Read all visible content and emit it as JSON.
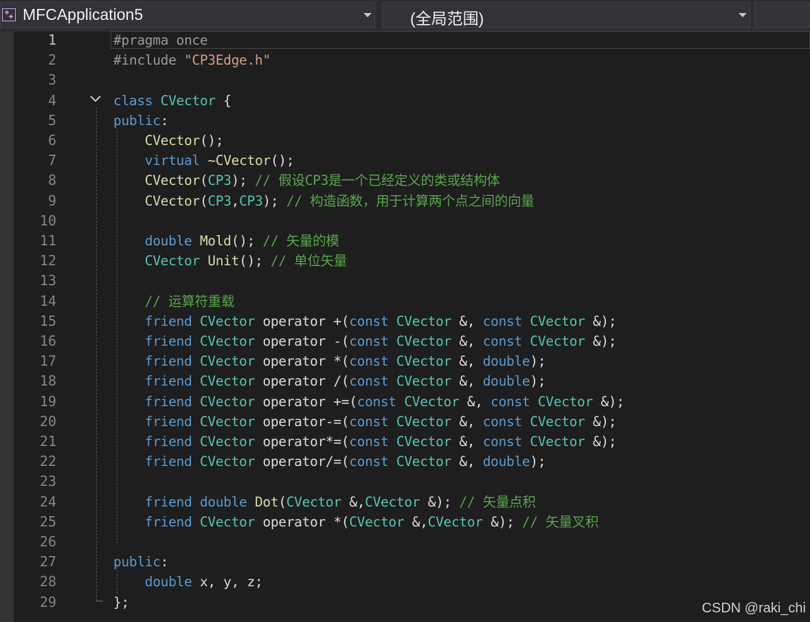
{
  "navbar": {
    "project_name": "MFCApplication5",
    "scope": "(全局范围)",
    "project_icon": "cpp-project-icon",
    "dropdown_icon": "chevron-down-icon"
  },
  "editor": {
    "line_numbers": [
      "1",
      "2",
      "3",
      "4",
      "5",
      "6",
      "7",
      "8",
      "9",
      "10",
      "11",
      "12",
      "13",
      "14",
      "15",
      "16",
      "17",
      "18",
      "19",
      "20",
      "21",
      "22",
      "23",
      "24",
      "25",
      "26",
      "27",
      "28",
      "29"
    ],
    "lines": [
      [
        [
          "pp",
          "#pragma once"
        ]
      ],
      [
        [
          "pp",
          "#include "
        ],
        [
          "str",
          "\"CP3Edge.h\""
        ]
      ],
      [],
      [
        [
          "kw",
          "class "
        ],
        [
          "ty",
          "CVector"
        ],
        [
          "pu",
          " {"
        ]
      ],
      [
        [
          "kw",
          "public"
        ],
        [
          "pu",
          ":"
        ]
      ],
      [
        [
          "pu",
          "    "
        ],
        [
          "fn",
          "CVector"
        ],
        [
          "pu",
          "();"
        ]
      ],
      [
        [
          "pu",
          "    "
        ],
        [
          "kw",
          "virtual "
        ],
        [
          "pu",
          "~"
        ],
        [
          "fn",
          "CVector"
        ],
        [
          "pu",
          "();"
        ]
      ],
      [
        [
          "pu",
          "    "
        ],
        [
          "fn",
          "CVector"
        ],
        [
          "pu",
          "("
        ],
        [
          "ty",
          "CP3"
        ],
        [
          "pu",
          "); "
        ],
        [
          "cm",
          "// 假设CP3是一个已经定义的类或结构体"
        ]
      ],
      [
        [
          "pu",
          "    "
        ],
        [
          "fn",
          "CVector"
        ],
        [
          "pu",
          "("
        ],
        [
          "ty",
          "CP3"
        ],
        [
          "pu",
          ","
        ],
        [
          "ty",
          "CP3"
        ],
        [
          "pu",
          "); "
        ],
        [
          "cm",
          "// 构造函数，用于计算两个点之间的向量"
        ]
      ],
      [],
      [
        [
          "pu",
          "    "
        ],
        [
          "kw",
          "double "
        ],
        [
          "fn",
          "Mold"
        ],
        [
          "pu",
          "(); "
        ],
        [
          "cm",
          "// 矢量的模"
        ]
      ],
      [
        [
          "pu",
          "    "
        ],
        [
          "ty",
          "CVector "
        ],
        [
          "fn",
          "Unit"
        ],
        [
          "pu",
          "(); "
        ],
        [
          "cm",
          "// 单位矢量"
        ]
      ],
      [],
      [
        [
          "pu",
          "    "
        ],
        [
          "cm",
          "// 运算符重载"
        ]
      ],
      [
        [
          "pu",
          "    "
        ],
        [
          "kw",
          "friend "
        ],
        [
          "ty",
          "CVector "
        ],
        [
          "pu",
          "operator +("
        ],
        [
          "kw",
          "const "
        ],
        [
          "ty",
          "CVector "
        ],
        [
          "pu",
          "&, "
        ],
        [
          "kw",
          "const "
        ],
        [
          "ty",
          "CVector "
        ],
        [
          "pu",
          "&);"
        ]
      ],
      [
        [
          "pu",
          "    "
        ],
        [
          "kw",
          "friend "
        ],
        [
          "ty",
          "CVector "
        ],
        [
          "pu",
          "operator -("
        ],
        [
          "kw",
          "const "
        ],
        [
          "ty",
          "CVector "
        ],
        [
          "pu",
          "&, "
        ],
        [
          "kw",
          "const "
        ],
        [
          "ty",
          "CVector "
        ],
        [
          "pu",
          "&);"
        ]
      ],
      [
        [
          "pu",
          "    "
        ],
        [
          "kw",
          "friend "
        ],
        [
          "ty",
          "CVector "
        ],
        [
          "pu",
          "operator *("
        ],
        [
          "kw",
          "const "
        ],
        [
          "ty",
          "CVector "
        ],
        [
          "pu",
          "&, "
        ],
        [
          "kw",
          "double"
        ],
        [
          "pu",
          ");"
        ]
      ],
      [
        [
          "pu",
          "    "
        ],
        [
          "kw",
          "friend "
        ],
        [
          "ty",
          "CVector "
        ],
        [
          "pu",
          "operator /("
        ],
        [
          "kw",
          "const "
        ],
        [
          "ty",
          "CVector "
        ],
        [
          "pu",
          "&, "
        ],
        [
          "kw",
          "double"
        ],
        [
          "pu",
          ");"
        ]
      ],
      [
        [
          "pu",
          "    "
        ],
        [
          "kw",
          "friend "
        ],
        [
          "ty",
          "CVector "
        ],
        [
          "pu",
          "operator +=("
        ],
        [
          "kw",
          "const "
        ],
        [
          "ty",
          "CVector "
        ],
        [
          "pu",
          "&, "
        ],
        [
          "kw",
          "const "
        ],
        [
          "ty",
          "CVector "
        ],
        [
          "pu",
          "&);"
        ]
      ],
      [
        [
          "pu",
          "    "
        ],
        [
          "kw",
          "friend "
        ],
        [
          "ty",
          "CVector "
        ],
        [
          "pu",
          "operator-=("
        ],
        [
          "kw",
          "const "
        ],
        [
          "ty",
          "CVector "
        ],
        [
          "pu",
          "&, "
        ],
        [
          "kw",
          "const "
        ],
        [
          "ty",
          "CVector "
        ],
        [
          "pu",
          "&);"
        ]
      ],
      [
        [
          "pu",
          "    "
        ],
        [
          "kw",
          "friend "
        ],
        [
          "ty",
          "CVector "
        ],
        [
          "pu",
          "operator*=("
        ],
        [
          "kw",
          "const "
        ],
        [
          "ty",
          "CVector "
        ],
        [
          "pu",
          "&, "
        ],
        [
          "kw",
          "const "
        ],
        [
          "ty",
          "CVector "
        ],
        [
          "pu",
          "&);"
        ]
      ],
      [
        [
          "pu",
          "    "
        ],
        [
          "kw",
          "friend "
        ],
        [
          "ty",
          "CVector "
        ],
        [
          "pu",
          "operator/=("
        ],
        [
          "kw",
          "const "
        ],
        [
          "ty",
          "CVector "
        ],
        [
          "pu",
          "&, "
        ],
        [
          "kw",
          "double"
        ],
        [
          "pu",
          ");"
        ]
      ],
      [],
      [
        [
          "pu",
          "    "
        ],
        [
          "kw",
          "friend "
        ],
        [
          "kw",
          "double "
        ],
        [
          "fn",
          "Dot"
        ],
        [
          "pu",
          "("
        ],
        [
          "ty",
          "CVector "
        ],
        [
          "pu",
          "&,"
        ],
        [
          "ty",
          "CVector "
        ],
        [
          "pu",
          "&); "
        ],
        [
          "cm",
          "// 矢量点积"
        ]
      ],
      [
        [
          "pu",
          "    "
        ],
        [
          "kw",
          "friend "
        ],
        [
          "ty",
          "CVector "
        ],
        [
          "pu",
          "operator *("
        ],
        [
          "ty",
          "CVector "
        ],
        [
          "pu",
          "&,"
        ],
        [
          "ty",
          "CVector "
        ],
        [
          "pu",
          "&); "
        ],
        [
          "cm",
          "// 矢量叉积"
        ]
      ],
      [],
      [
        [
          "kw",
          "public"
        ],
        [
          "pu",
          ":"
        ]
      ],
      [
        [
          "pu",
          "    "
        ],
        [
          "kw",
          "double "
        ],
        [
          "pu",
          "x, y, z;"
        ]
      ],
      [
        [
          "pu",
          "};"
        ]
      ]
    ]
  },
  "watermark": "CSDN @raki_chi",
  "colors": {
    "keyword": "#569cd6",
    "type": "#4ec9b0",
    "function": "#dcdcaa",
    "string": "#d69d85",
    "comment": "#57a64a",
    "preprocessor": "#9b9b9b",
    "background": "#1e1e1e"
  }
}
